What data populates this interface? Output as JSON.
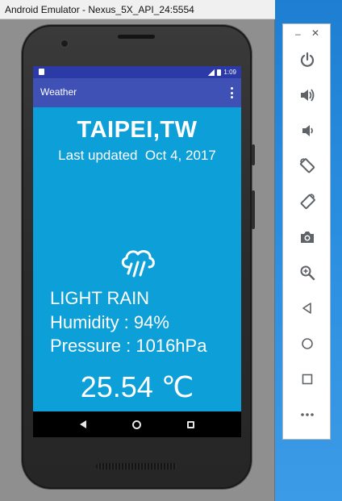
{
  "window": {
    "title": "Android Emulator - Nexus_5X_API_24:5554"
  },
  "status_bar": {
    "time": "1:09"
  },
  "app_bar": {
    "title": "Weather"
  },
  "weather": {
    "city": "TAIPEI,TW",
    "last_updated": "Last updated  Oct 4, 2017",
    "description": "LIGHT RAIN",
    "humidity": "Humidity : 94%",
    "pressure": "Pressure : 1016hPa",
    "temperature": "25.54 ℃",
    "icon": "cloud-rain-icon"
  },
  "toolbar": {
    "minimize_label": "–",
    "close_label": "✕",
    "buttons": [
      "power-icon",
      "volume-up-icon",
      "volume-down-icon",
      "rotate-left-icon",
      "rotate-right-icon",
      "camera-icon",
      "zoom-icon",
      "back-icon",
      "home-icon",
      "overview-icon",
      "more-icon"
    ]
  },
  "colors": {
    "screen_bg": "#0c9fd8",
    "app_bar": "#3f51b5",
    "status_bar": "#2b3aa6",
    "toolbar_icon": "#5f6368"
  }
}
